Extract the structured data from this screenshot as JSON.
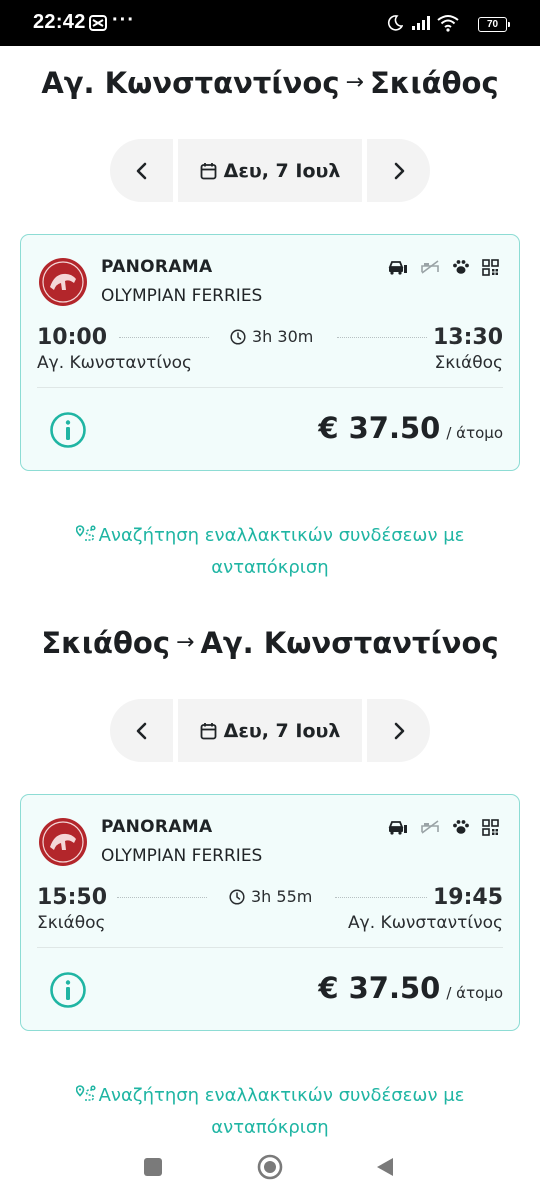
{
  "status_bar": {
    "time": "22:42",
    "more": "···",
    "battery": "70"
  },
  "outbound": {
    "from": "Αγ. Κωνσταντίνος",
    "arrow": "→",
    "to": "Σκιάθος",
    "date_label": "Δευ, 7 Ιουλ",
    "trip": {
      "vessel": "PANORAMA",
      "company": "OLYMPIAN FERRIES",
      "departure_time": "10:00",
      "departure_port": "Αγ. Κωνσταντίνος",
      "duration": "3h 30m",
      "arrival_time": "13:30",
      "arrival_port": "Σκιάθος",
      "price": "€ 37.50",
      "price_unit": "/ άτομο"
    },
    "alt_link": "Αναζήτηση εναλλακτικών συνδέσεων με ανταπόκριση"
  },
  "return": {
    "from": "Σκιάθος",
    "arrow": "→",
    "to": "Αγ. Κωνσταντίνος",
    "date_label": "Δευ, 7 Ιουλ",
    "trip": {
      "vessel": "PANORAMA",
      "company": "OLYMPIAN FERRIES",
      "departure_time": "15:50",
      "departure_port": "Σκιάθος",
      "duration": "3h 55m",
      "arrival_time": "19:45",
      "arrival_port": "Αγ. Κωνσταντίνος",
      "price": "€ 37.50",
      "price_unit": "/ άτομο"
    },
    "alt_link": "Αναζήτηση εναλλακτικών συνδέσεων με ανταπόκριση"
  },
  "amenity_icons": [
    "car-icon",
    "no-cabin-icon",
    "pet-icon",
    "qr-code-icon"
  ],
  "colors": {
    "accent": "#1fb5a3",
    "card_bg": "#f2fcfb",
    "card_border": "#8ddcd4",
    "logo_red": "#b3262b"
  }
}
